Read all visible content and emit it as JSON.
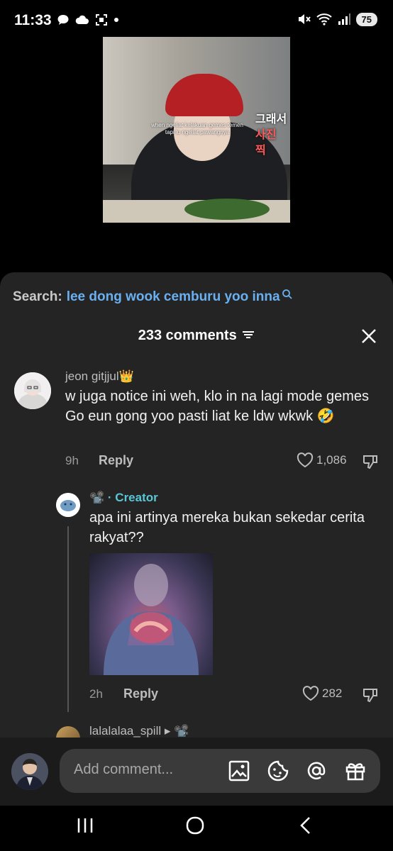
{
  "status_bar": {
    "time": "11:33",
    "battery": "75"
  },
  "video": {
    "caption_line1": "when ngeliat kelakuan gemes temen",
    "caption_line2": "tapi lu ngeliat pawangnya",
    "korean_line1": "그래서",
    "korean_line2": "사진 찍"
  },
  "search": {
    "prefix": "Search:",
    "query": "lee dong wook cemburu yoo inna"
  },
  "comments_header": {
    "count_label": "233 comments"
  },
  "comments": [
    {
      "username": "jeon gitjjul",
      "badge": "👑",
      "text": "w juga notice ini weh, klo in na lagi mode gemes Go eun gong yoo pasti liat ke ldw wkwk 🤣",
      "time": "9h",
      "reply_label": "Reply",
      "likes": "1,086"
    }
  ],
  "reply": {
    "prefix_icon": "📽️",
    "label": "· Creator",
    "text": "apa ini artinya mereka bukan sekedar cerita rakyat??",
    "time": "2h",
    "reply_label": "Reply",
    "likes": "282"
  },
  "next_reply": {
    "username": "lalalalaa_spill",
    "suffix": "▸ 📽️"
  },
  "input": {
    "placeholder": "Add comment..."
  }
}
